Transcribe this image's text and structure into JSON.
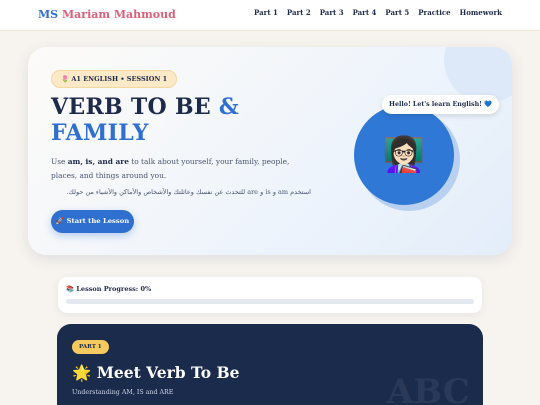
{
  "brand": {
    "initials": "MS",
    "name": "Mariam Mahmoud"
  },
  "nav": [
    "Part 1",
    "Part 2",
    "Part 3",
    "Part 4",
    "Part 5",
    "Practice",
    "Homework"
  ],
  "hero": {
    "badge_icon": "🌷",
    "badge_text": "A1 ENGLISH • SESSION 1",
    "title_main": "VERB TO BE",
    "title_amp": "&",
    "title_blue": "FAMILY",
    "desc_prefix": "Use ",
    "desc_bold": "am, is, and are",
    "desc_rest": " to talk about yourself, your family, people, places, and things around you.",
    "arabic": "استخدم am و is و are للتحدث عن نفسك وعائلتك والأشخاص والأماكن والأشياء من حولك.",
    "button_icon": "🚀",
    "button_label": "Start the Lesson",
    "speech": "Hello! Let's learn English! 💙",
    "avatar_icon": "👩🏻‍🏫"
  },
  "progress": {
    "icon": "📚",
    "label": "Lesson Progress:",
    "value_text": "0%",
    "value": 0
  },
  "part": {
    "badge": "PART 1",
    "icon": "🌟",
    "title": "Meet Verb To Be",
    "subtitle": "Understanding AM, IS and ARE",
    "decoration": "ABC"
  },
  "colors": {
    "accent": "#2f6fcf",
    "brand_pink": "#d9607a",
    "navy": "#1b2b4c",
    "badge_yellow": "#f4c95d"
  }
}
